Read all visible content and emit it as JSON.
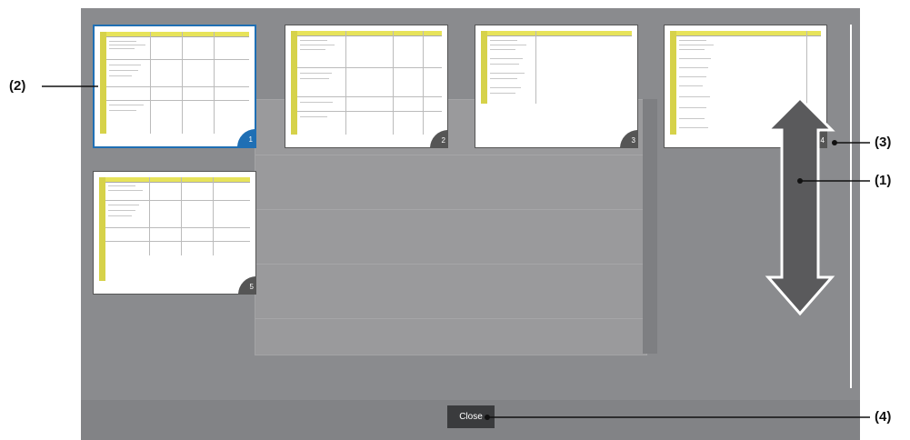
{
  "callouts": {
    "c1": "(1)",
    "c2": "(2)",
    "c3": "(3)",
    "c4": "(4)"
  },
  "thumbnails": [
    {
      "page": "1",
      "selected": true
    },
    {
      "page": "2",
      "selected": false
    },
    {
      "page": "3",
      "selected": false
    },
    {
      "page": "4",
      "selected": false
    },
    {
      "page": "5",
      "selected": false
    }
  ],
  "close_label": "Close",
  "colors": {
    "overlay": "#8a8b8e",
    "selected_border": "#1f6fb4",
    "table_header": "#e7e35a",
    "arrow": "#5a5a5c"
  },
  "icons": {
    "scroll_arrow": "double-arrow-vertical-icon"
  }
}
